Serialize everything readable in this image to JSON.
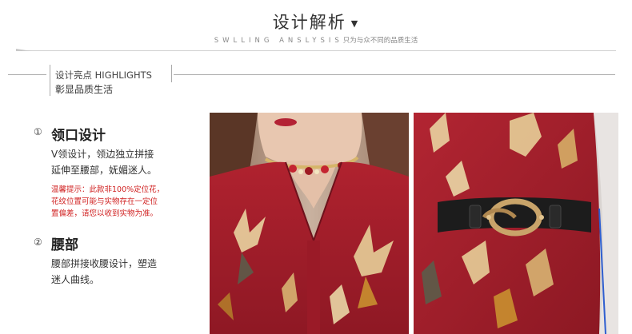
{
  "header": {
    "title": "设计解析",
    "arrow": "▼",
    "subtitle_en": "SWLLING ANSLYSIS",
    "subtitle_cn": "只为与众不同的品质生活"
  },
  "highlights": {
    "title": "设计亮点 HIGHLIGHTS",
    "subtitle": "彰显品质生活"
  },
  "features": [
    {
      "number": "①",
      "title": "领口设计",
      "desc_lines": [
        "V领设计，领边独立拼接",
        "延伸至腰部，妩媚迷人。"
      ],
      "note_lines": [
        "温馨提示：此款非100%定位花，",
        "花纹位置可能与实物存在一定位",
        "置偏差，请您以收到实物为准。"
      ]
    },
    {
      "number": "②",
      "title": "腰部",
      "desc_lines": [
        "腰部拼接收腰设计，塑造",
        "迷人曲线。"
      ]
    }
  ],
  "colors": {
    "dress_red": "#a81e2c",
    "dress_dark": "#7a1420",
    "note_red": "#d02020",
    "belt": "#1c1c1c",
    "buckle_gold": "#c9a46a"
  },
  "images": {
    "left": "neckline-closeup-photo",
    "right": "waist-belt-closeup-photo"
  }
}
